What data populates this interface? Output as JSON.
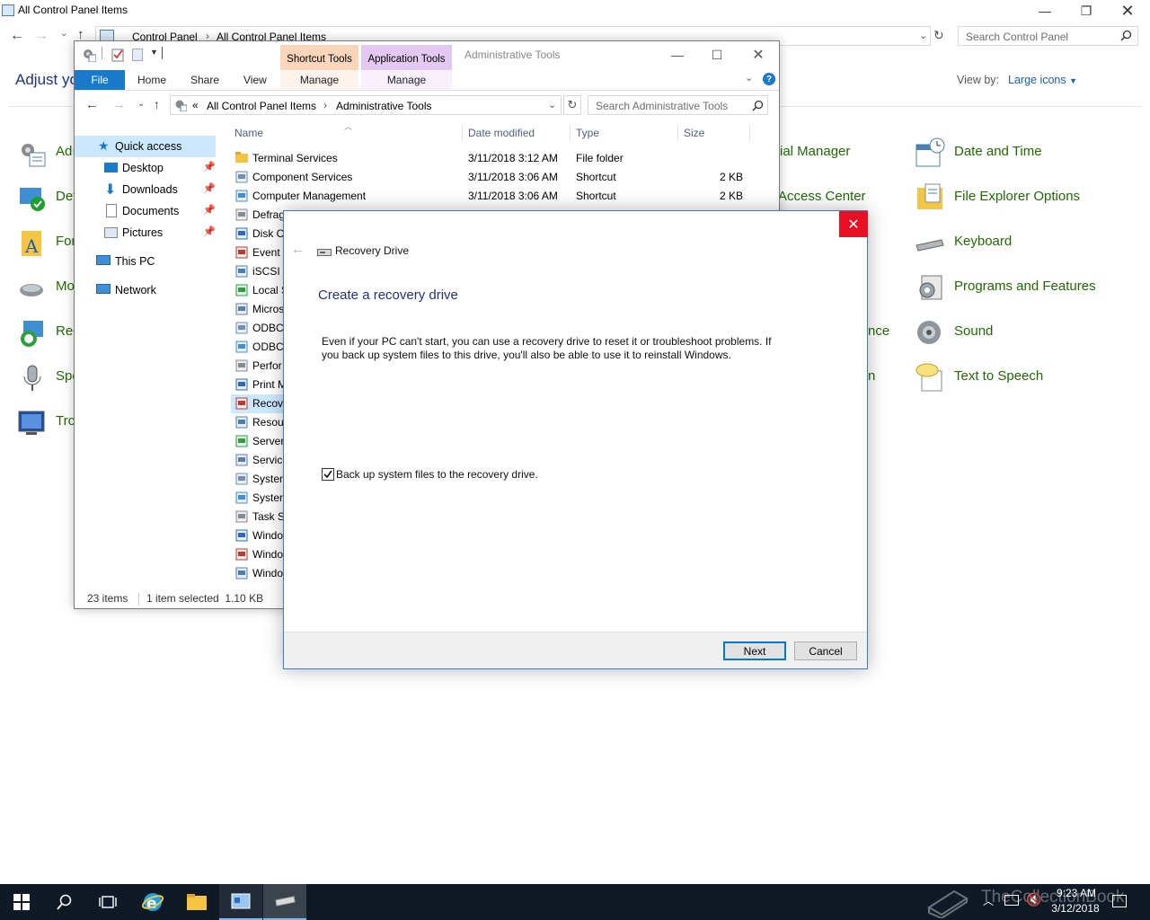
{
  "control_panel": {
    "title": "All Control Panel Items",
    "breadcrumb": [
      "Control Panel",
      "All Control Panel Items"
    ],
    "search_placeholder": "Search Control Panel",
    "heading_partial": "Adjust yo",
    "view_by_label": "View by:",
    "view_by_value": "Large icons",
    "left_items": [
      "Adı",
      "Det",
      "For",
      "Mo",
      "Rec",
      "Spe",
      "Tro"
    ],
    "mid_items": [
      "ial Manager",
      "Access Center",
      "nce",
      "n"
    ],
    "right_items": [
      "Date and Time",
      "File Explorer Options",
      "Keyboard",
      "Programs and Features",
      "Sound",
      "Text to Speech"
    ]
  },
  "explorer": {
    "title": "Administrative Tools",
    "ctx_tabs": [
      "Shortcut Tools",
      "Application Tools"
    ],
    "ribbon_tabs": [
      "File",
      "Home",
      "Share",
      "View",
      "Manage",
      "Manage"
    ],
    "address": [
      "All Control Panel Items",
      "Administrative Tools"
    ],
    "address_prefix": "«",
    "search_placeholder": "Search Administrative Tools",
    "nav": {
      "quick_access": "Quick access",
      "pinned": [
        "Desktop",
        "Downloads",
        "Documents",
        "Pictures"
      ],
      "this_pc": "This PC",
      "network": "Network"
    },
    "columns": [
      "Name",
      "Date modified",
      "Type",
      "Size"
    ],
    "files": [
      {
        "name": "Terminal Services",
        "date": "3/11/2018 3:12 AM",
        "type": "File folder",
        "size": ""
      },
      {
        "name": "Component Services",
        "date": "3/11/2018 3:06 AM",
        "type": "Shortcut",
        "size": "2 KB"
      },
      {
        "name": "Computer Management",
        "date": "3/11/2018 3:06 AM",
        "type": "Shortcut",
        "size": "2 KB"
      },
      {
        "name": "Defrag",
        "date": "",
        "type": "",
        "size": ""
      },
      {
        "name": "Disk C",
        "date": "",
        "type": "",
        "size": ""
      },
      {
        "name": "Event V",
        "date": "",
        "type": "",
        "size": ""
      },
      {
        "name": "iSCSI In",
        "date": "",
        "type": "",
        "size": ""
      },
      {
        "name": "Local S",
        "date": "",
        "type": "",
        "size": ""
      },
      {
        "name": "Micros",
        "date": "",
        "type": "",
        "size": ""
      },
      {
        "name": "ODBC",
        "date": "",
        "type": "",
        "size": ""
      },
      {
        "name": "ODBC",
        "date": "",
        "type": "",
        "size": ""
      },
      {
        "name": "Perfor",
        "date": "",
        "type": "",
        "size": ""
      },
      {
        "name": "Print M",
        "date": "",
        "type": "",
        "size": ""
      },
      {
        "name": "Recove",
        "date": "",
        "type": "",
        "size": ""
      },
      {
        "name": "Resour",
        "date": "",
        "type": "",
        "size": ""
      },
      {
        "name": "Server",
        "date": "",
        "type": "",
        "size": ""
      },
      {
        "name": "Service",
        "date": "",
        "type": "",
        "size": ""
      },
      {
        "name": "System",
        "date": "",
        "type": "",
        "size": ""
      },
      {
        "name": "System",
        "date": "",
        "type": "",
        "size": ""
      },
      {
        "name": "Task Sc",
        "date": "",
        "type": "",
        "size": ""
      },
      {
        "name": "Windo",
        "date": "",
        "type": "",
        "size": ""
      },
      {
        "name": "Windo",
        "date": "",
        "type": "",
        "size": ""
      },
      {
        "name": "Windo",
        "date": "",
        "type": "",
        "size": ""
      }
    ],
    "status_count": "23 items",
    "status_selected": "1 item selected  1.10 KB"
  },
  "dialog": {
    "app_name": "Recovery Drive",
    "heading": "Create a recovery drive",
    "body_line1": "Even if your PC can't start, you can use a recovery drive to reset it or troubleshoot problems. If",
    "body_line2": "you back up system files to this drive, you'll also be able to use it to reinstall Windows.",
    "checkbox_label": "Back up system files to the recovery drive.",
    "checkbox_checked": true,
    "next_label": "Next",
    "cancel_label": "Cancel"
  },
  "taskbar": {
    "time": "9:23 AM",
    "date": "3/12/2018",
    "watermark": "TheCollectionBook"
  },
  "colors": {
    "accent": "#0078d7",
    "link_green": "#1e6b00",
    "close_red": "#e81123",
    "taskbar": "#101a26"
  }
}
